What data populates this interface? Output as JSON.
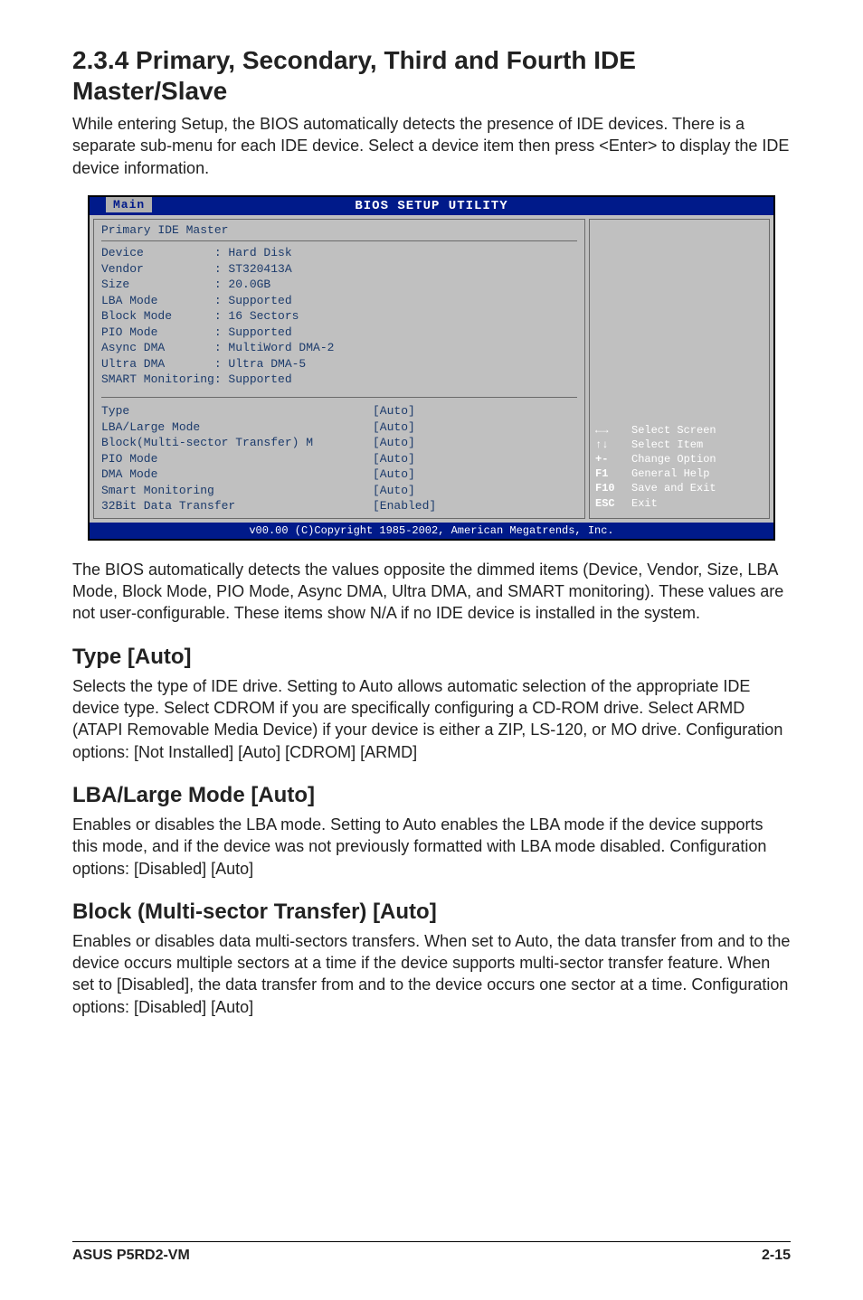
{
  "header": {
    "title": "2.3.4   Primary, Secondary, Third and Fourth IDE Master/Slave",
    "intro": "While entering Setup, the BIOS automatically detects the presence of IDE devices. There is a separate sub-menu for each IDE device. Select a device item then press <Enter> to display the IDE device information."
  },
  "bios": {
    "titlebar": "BIOS SETUP UTILITY",
    "tab": "Main",
    "panel_title": "Primary IDE Master",
    "info": [
      "Device          : Hard Disk",
      "Vendor          : ST320413A",
      "Size            : 20.0GB",
      "LBA Mode        : Supported",
      "Block Mode      : 16 Sectors",
      "PIO Mode        : Supported",
      "Async DMA       : MultiWord DMA-2",
      "Ultra DMA       : Ultra DMA-5",
      "SMART Monitoring: Supported"
    ],
    "settings": [
      {
        "label": "Type",
        "val": "[Auto]"
      },
      {
        "label": "LBA/Large Mode",
        "val": "[Auto]"
      },
      {
        "label": "Block(Multi-sector Transfer) M",
        "val": "[Auto]"
      },
      {
        "label": "PIO Mode",
        "val": "[Auto]"
      },
      {
        "label": "DMA Mode",
        "val": "[Auto]"
      },
      {
        "label": "Smart Monitoring",
        "val": "[Auto]"
      },
      {
        "label": "32Bit Data Transfer",
        "val": "[Enabled]"
      }
    ],
    "help": [
      {
        "key": "←→",
        "desc": "Select Screen"
      },
      {
        "key": "↑↓",
        "desc": "Select Item"
      },
      {
        "key": "+-",
        "desc": "Change Option"
      },
      {
        "key": "F1",
        "desc": "General Help"
      },
      {
        "key": "F10",
        "desc": "Save and Exit"
      },
      {
        "key": "ESC",
        "desc": "Exit"
      }
    ],
    "footer": "v00.00 (C)Copyright 1985-2002, American Megatrends, Inc."
  },
  "after_bios": "The BIOS automatically detects the values opposite the dimmed items (Device, Vendor, Size, LBA Mode, Block Mode, PIO Mode, Async DMA, Ultra DMA, and SMART monitoring). These values are not user-configurable. These items show N/A if no IDE device is installed in the system.",
  "sections": {
    "type": {
      "h": "Type [Auto]",
      "p": "Selects the type of IDE drive. Setting to Auto allows automatic selection of the appropriate IDE device type. Select CDROM if you are specifically configuring a CD-ROM drive. Select ARMD (ATAPI Removable Media Device) if your device is either a ZIP, LS-120, or MO drive. Configuration options: [Not Installed] [Auto] [CDROM] [ARMD]"
    },
    "lba": {
      "h": "LBA/Large Mode [Auto]",
      "p": "Enables or disables the LBA mode. Setting to Auto enables the LBA mode if the device supports this mode, and if the device was not previously formatted with LBA mode disabled. Configuration options: [Disabled] [Auto]"
    },
    "block": {
      "h": "Block (Multi-sector Transfer) [Auto]",
      "p": "Enables or disables data multi-sectors transfers. When set to Auto, the data transfer from and to the device occurs multiple sectors at a time if the device supports multi-sector transfer feature. When set to [Disabled], the data transfer from and to the device occurs one sector at a time. Configuration options: [Disabled] [Auto]"
    }
  },
  "footer": {
    "left": "ASUS P5RD2-VM",
    "right": "2-15"
  }
}
